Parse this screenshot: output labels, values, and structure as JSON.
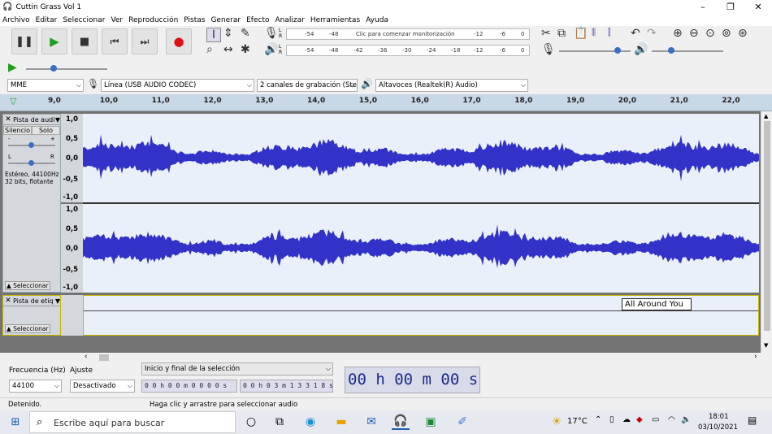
{
  "window": {
    "title": "Cuttin Grass Vol 1",
    "minimize": "–",
    "maximize": "❐",
    "close": "✕"
  },
  "menu": [
    "Archivo",
    "Editar",
    "Seleccionar",
    "Ver",
    "Reproducción",
    "Pistas",
    "Generar",
    "Efecto",
    "Analizar",
    "Herramientas",
    "Ayuda"
  ],
  "meters": {
    "record_hint": "Clic para comenzar monitorización",
    "record_ticks": [
      "-54",
      "-48",
      "-12",
      "-6",
      "0"
    ],
    "play_ticks": [
      "-54",
      "-48",
      "-42",
      "-36",
      "-30",
      "-24",
      "-18",
      "-12",
      "-6",
      "0"
    ]
  },
  "devices": {
    "host": "MME",
    "input": "Línea (USB AUDIO  CODEC)",
    "channels": "2 canales de grabación (Ster",
    "output": "Altavoces (Realtek(R) Audio)"
  },
  "ruler": {
    "ticks": [
      "9,0",
      "10,0",
      "11,0",
      "12,0",
      "13,0",
      "14,0",
      "15,0",
      "16,0",
      "17,0",
      "18,0",
      "19,0",
      "20,0",
      "21,0",
      "22,0"
    ]
  },
  "audio_track": {
    "name": "Pista de audi",
    "mute": "Silencio",
    "solo": "Solo",
    "gain_left": "-",
    "gain_right": "+",
    "pan_left": "L",
    "pan_right": "R",
    "info": "Estéreo, 44100Hz\n32 bits, flotante",
    "select": "Seleccionar",
    "scale": [
      "1,0",
      "0,5",
      "0,0",
      "-0,5",
      "-1,0"
    ]
  },
  "label_track": {
    "name": "Pista de etiq",
    "select": "Seleccionar",
    "label_text": "All Around You"
  },
  "bottom": {
    "rate_label": "Frecuencia (Hz)",
    "rate_value": "44100",
    "snap_label": "Ajuste",
    "snap_value": "Desactivado",
    "selection_mode": "Inicio y final de la selección",
    "sel_start": "0 0 h 0 0 m 0 0 0 0 s",
    "sel_end": "0 0 h 0 3 m 1 3 3 1 8 s",
    "time": "00 h 00 m 00 s"
  },
  "status": {
    "state": "Detenido.",
    "hint": "Haga clic y arrastre para seleccionar audio"
  },
  "taskbar": {
    "search_placeholder": "Escribe aquí para buscar",
    "temperature": "17°C",
    "time": "18:01",
    "date": "03/10/2021"
  },
  "colors": {
    "waveform": "#3232c8",
    "ruler": "#c9d8e6",
    "track_bg": "#eaf0fa",
    "record_red": "#e01010",
    "play_green": "#1ea01e"
  }
}
